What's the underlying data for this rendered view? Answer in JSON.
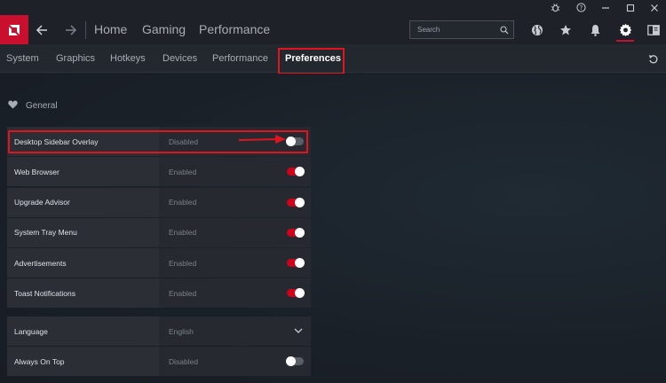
{
  "topnav": {
    "items": [
      "Home",
      "Gaming",
      "Performance"
    ]
  },
  "search": {
    "placeholder": "Search"
  },
  "tabs": [
    {
      "label": "System"
    },
    {
      "label": "Graphics"
    },
    {
      "label": "Hotkeys"
    },
    {
      "label": "Devices"
    },
    {
      "label": "Performance"
    },
    {
      "label": "Preferences",
      "active": true
    }
  ],
  "section": {
    "title": "General"
  },
  "settings_group1": [
    {
      "label": "Desktop Sidebar Overlay",
      "value": "Disabled",
      "on": false
    },
    {
      "label": "Web Browser",
      "value": "Enabled",
      "on": true
    },
    {
      "label": "Upgrade Advisor",
      "value": "Enabled",
      "on": true
    },
    {
      "label": "System Tray Menu",
      "value": "Enabled",
      "on": true
    },
    {
      "label": "Advertisements",
      "value": "Enabled",
      "on": true
    },
    {
      "label": "Toast Notifications",
      "value": "Enabled",
      "on": true
    }
  ],
  "settings_group2": [
    {
      "label": "Language",
      "value": "English",
      "type": "dropdown"
    },
    {
      "label": "Always On Top",
      "value": "Disabled",
      "on": false
    }
  ],
  "colors": {
    "accent": "#d0021b",
    "annotation": "#e0141e"
  },
  "icons": {
    "titlebar": [
      "bug-icon",
      "help-icon",
      "minimize-icon",
      "maximize-icon",
      "close-icon"
    ],
    "toolbar": [
      "globe-icon",
      "star-icon",
      "bell-icon",
      "gear-icon",
      "sidebar-icon"
    ]
  }
}
